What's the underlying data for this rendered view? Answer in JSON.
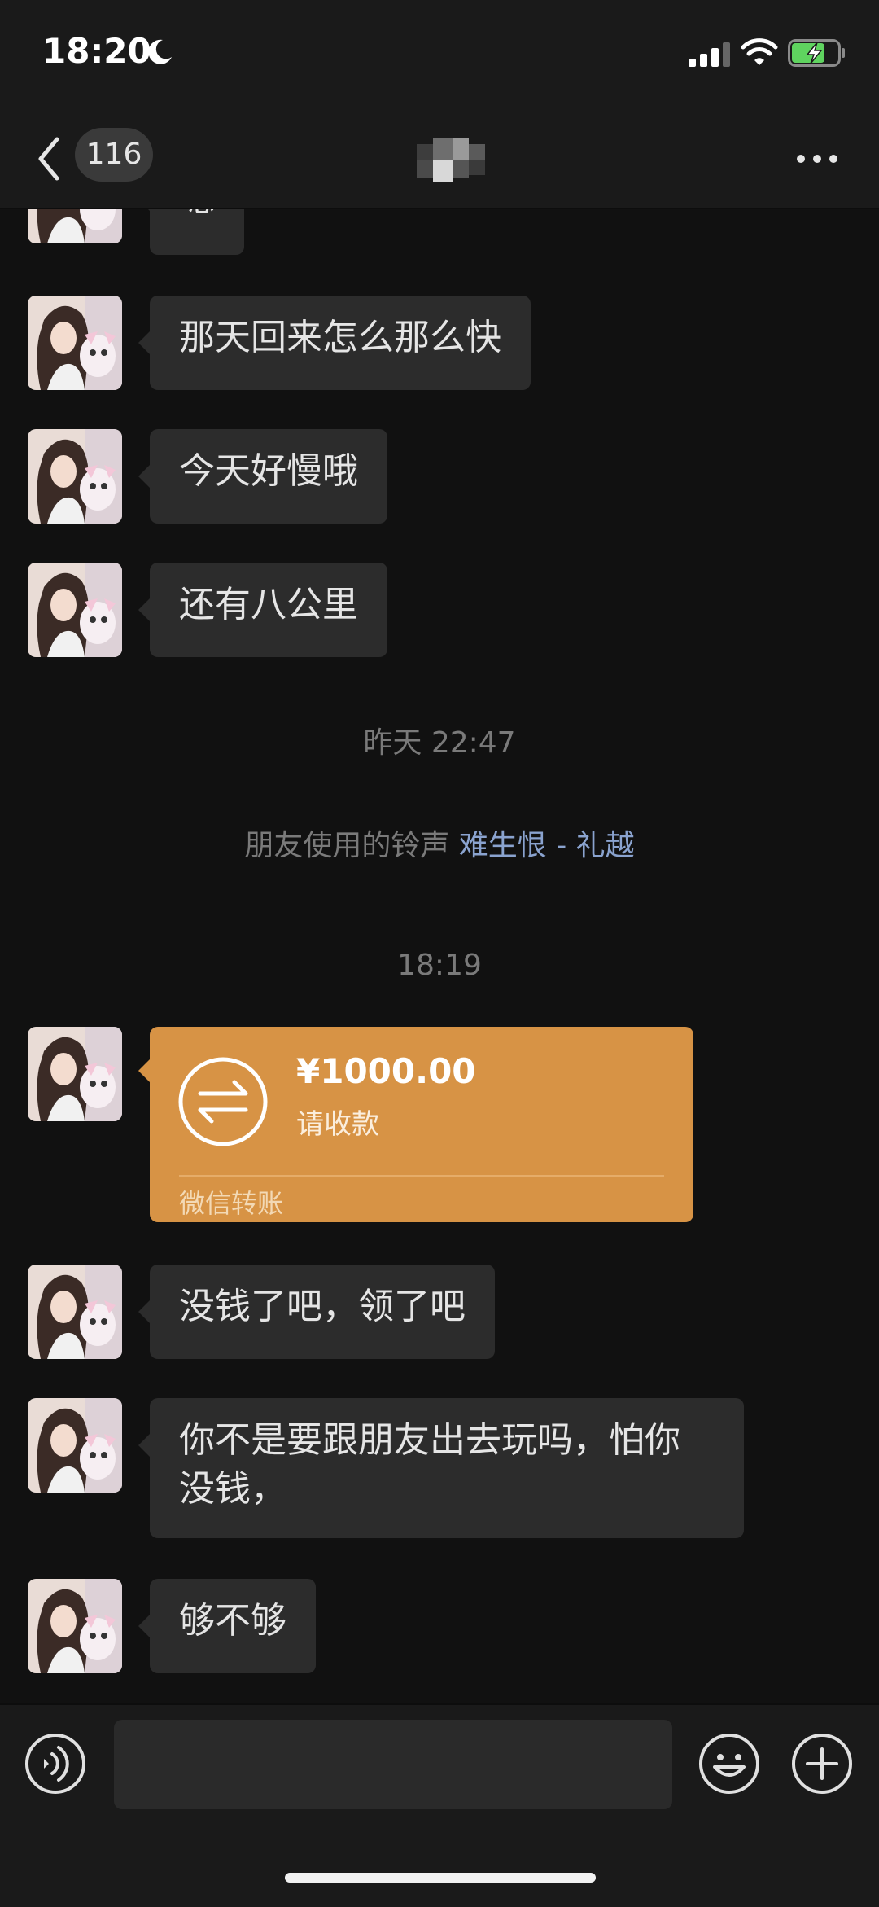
{
  "status_bar": {
    "time": "18:20",
    "icons": [
      "moon-icon",
      "signal-icon",
      "wifi-icon",
      "battery-charging-icon"
    ]
  },
  "nav": {
    "unread_count": "116",
    "icons": [
      "back-icon",
      "more-icon"
    ]
  },
  "messages": [
    {
      "type": "text",
      "text": "嗯"
    },
    {
      "type": "text",
      "text": "那天回来怎么那么快"
    },
    {
      "type": "text",
      "text": "今天好慢哦"
    },
    {
      "type": "text",
      "text": "还有八公里"
    },
    {
      "type": "time",
      "text": "昨天 22:47"
    },
    {
      "type": "ringtone",
      "prefix": "朋友使用的铃声",
      "song": "难生恨 - 礼越"
    },
    {
      "type": "time",
      "text": "18:19"
    },
    {
      "type": "transfer",
      "amount": "¥1000.00",
      "status": "请收款",
      "footer": "微信转账"
    },
    {
      "type": "text",
      "text": "没钱了吧，领了吧"
    },
    {
      "type": "text",
      "text_line1": "你不是要跟朋友出去玩吗，怕你",
      "text_line2": "没钱，"
    },
    {
      "type": "text",
      "text": "够不够"
    }
  ],
  "input_bar": {
    "placeholder": "",
    "icons": [
      "voice-icon",
      "emoji-icon",
      "plus-icon"
    ]
  },
  "colors": {
    "background": "#111111",
    "bubble": "#2c2c2c",
    "transfer": "#d79345",
    "link": "#8aa3cf"
  }
}
